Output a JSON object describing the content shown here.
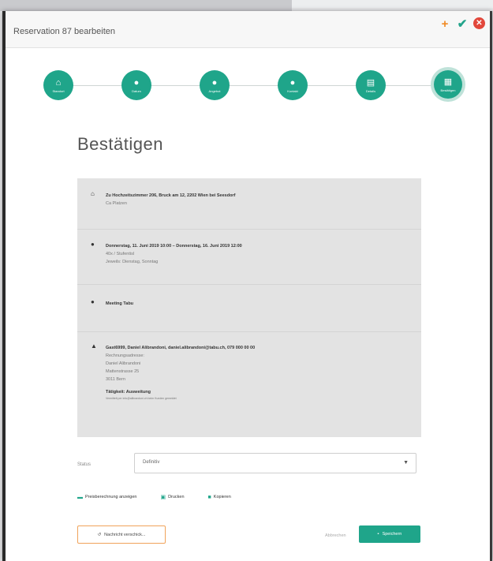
{
  "window": {
    "title": "Reservation 87 bearbeiten"
  },
  "titlebar_actions": [
    {
      "name": "add",
      "glyph": "+"
    },
    {
      "name": "confirm",
      "glyph": "✔"
    },
    {
      "name": "close",
      "glyph": "✕"
    }
  ],
  "steps": [
    {
      "label": "Standort",
      "icon": "home-icon",
      "glyph": "⌂"
    },
    {
      "label": "Datum",
      "icon": "clock-icon",
      "glyph": "●"
    },
    {
      "label": "Angebot",
      "icon": "info-icon",
      "glyph": "●"
    },
    {
      "label": "Kontakt",
      "icon": "user-icon",
      "glyph": "●"
    },
    {
      "label": "Details",
      "icon": "document-icon",
      "glyph": "▤"
    },
    {
      "label": "Bestätigen",
      "icon": "calendar-check-icon",
      "glyph": "▦"
    }
  ],
  "page": {
    "heading": "Bestätigen"
  },
  "summary": {
    "location": {
      "line1": "Zu Hochzeitszimmer 206, Bruck am 12, 2202 Wien bei Seesdorf",
      "line2": "Ca Platzen"
    },
    "date": {
      "line1": "Donnerstag, 11. Juni 2019 10:00 – Donnerstag, 16. Juni 2019 12:00",
      "line2": "40x / Stufentisl",
      "line3": "Jeweils: Dienstag, Sonntag"
    },
    "offer": {
      "line1": "Meeting Tabu"
    },
    "contact": {
      "line1": "Gast6999, Daniel Alibrandoni, daniel.alibrandoni@tabu.ch, 079 000 00 00",
      "address": [
        "Rechnungsadresse:",
        "Daniel Alibrandoni",
        "Mattenstrasse 25",
        "3011 Bern"
      ],
      "extra_label": "Tätigkeit: Ausweitung",
      "extra_note": "Vermittelt per info@alibrandoni.ch beim Kunden gemeldet"
    }
  },
  "status": {
    "label": "Status",
    "value": "Definitiv"
  },
  "links": [
    {
      "label": "Preisberechnung anzeigen",
      "icon": "money-icon",
      "glyph": "▬"
    },
    {
      "label": "Drucken",
      "icon": "print-icon",
      "glyph": "▣"
    },
    {
      "label": "Kopieren",
      "icon": "copy-icon",
      "glyph": "■"
    }
  ],
  "footer": {
    "reset_label": "Nachricht verschick...",
    "cancel_label": "Abbrechen",
    "save_label": "Speichern"
  },
  "colors": {
    "accent": "#1fa58a",
    "panel": "#e3e3e3",
    "warning": "#f08a24",
    "danger": "#e2473b"
  }
}
